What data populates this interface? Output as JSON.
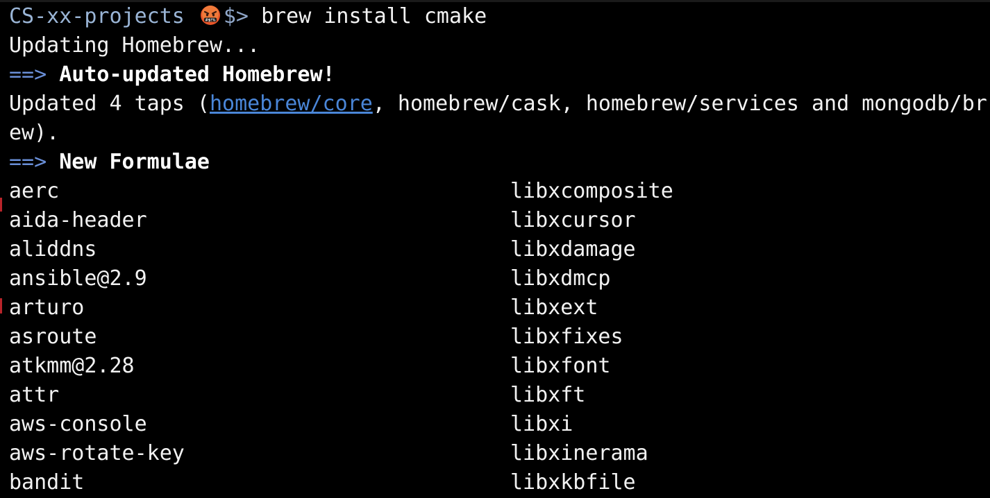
{
  "prompt": {
    "directory": "CS-xx-projects",
    "symbol": "$>",
    "command": "brew install cmake",
    "emoji_icon": "angry-face-with-symbols-emoji"
  },
  "output": {
    "updating": "Updating Homebrew...",
    "arrow": "==>",
    "auto_updated": "Auto-updated Homebrew!",
    "taps_prefix": "Updated 4 taps (",
    "taps_link": "homebrew/core",
    "taps_suffix": ", homebrew/cask, homebrew/services and mongodb/br",
    "taps_wrap": "ew).",
    "new_formulae": "New Formulae"
  },
  "formulae": {
    "left": [
      "aerc",
      "aida-header",
      "aliddns",
      "ansible@2.9",
      "arturo",
      "asroute",
      "atkmm@2.28",
      "attr",
      "aws-console",
      "aws-rotate-key",
      "bandit"
    ],
    "right": [
      "libxcomposite",
      "libxcursor",
      "libxdamage",
      "libxdmcp",
      "libxext",
      "libxfixes",
      "libxfont",
      "libxft",
      "libxi",
      "libxinerama",
      "libxkbfile"
    ]
  },
  "colors": {
    "background": "#000000",
    "text": "#f2f2f2",
    "directory": "#9ab5d6",
    "arrow": "#6a8fd8",
    "link": "#4a86d8"
  }
}
